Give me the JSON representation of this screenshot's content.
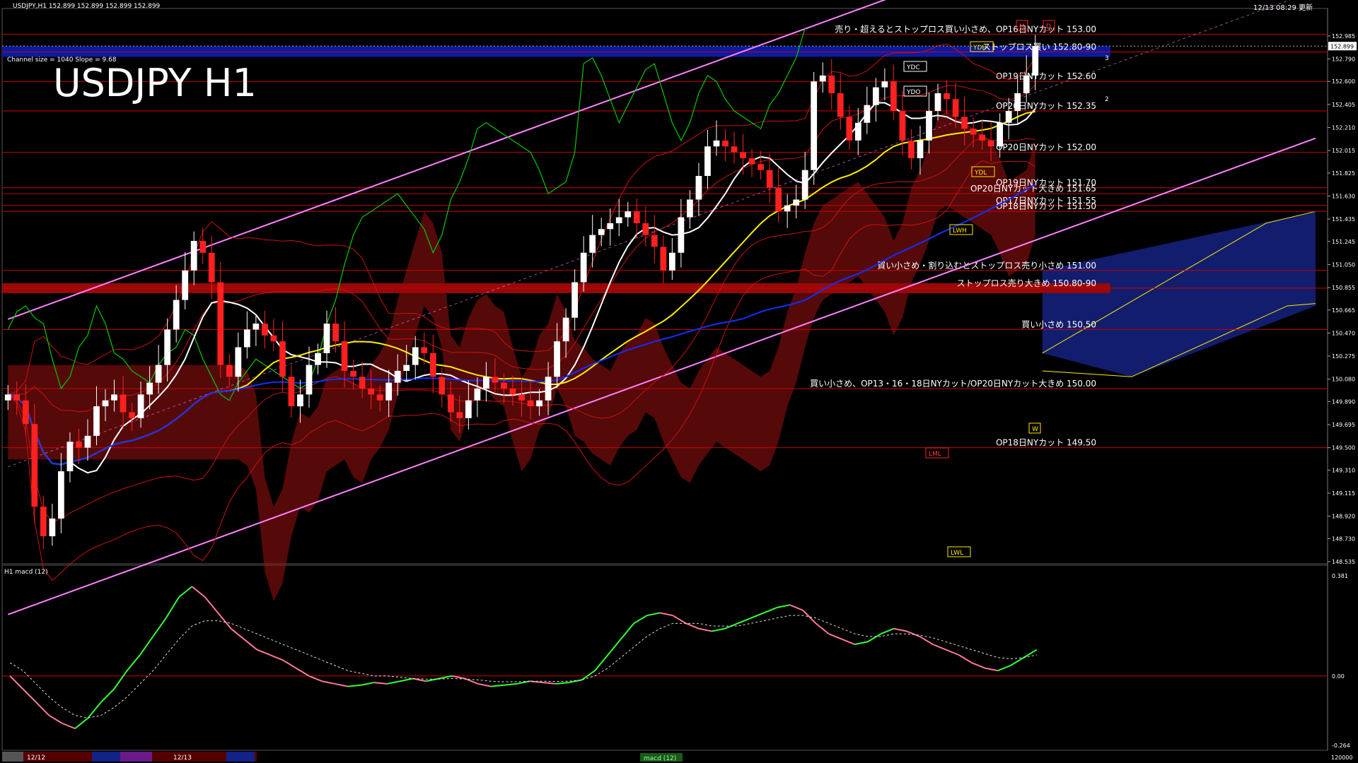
{
  "header": {
    "symbol_info": "USDJPY,H1  152.899 152.899 152.899 152.899",
    "datetime": "12/13 08:29 更新",
    "channel_info": "Channel size = 1040 Slope = 9.68",
    "big_title": "USDJPY H1"
  },
  "colors": {
    "bg": "#000000",
    "candle_up": "#ffffff",
    "candle_down": "#ff2020",
    "level_line": "#cc0000",
    "channel": "#ff80ff",
    "ma_white": "#ffffff",
    "ma_yellow": "#ffee00",
    "ma_blue": "#1030ff",
    "lagging_green": "#00cc00",
    "macd_green": "#33ff33",
    "macd_pink": "#ff7799",
    "kumo_red": "#9b1010",
    "kumo_blue": "#1b2a9b",
    "buy_zone": "#0a1aa0",
    "sell_zone": "#990808",
    "order_text": "#ffffff",
    "bar_color": "#ffe800"
  },
  "chart_data": [
    {
      "type": "candlestick",
      "title": "USDJPY H1",
      "y_ticks": [
        "152.985",
        "152.790",
        "152.600",
        "152.405",
        "152.210",
        "152.015",
        "151.825",
        "151.630",
        "151.435",
        "151.245",
        "151.050",
        "150.855",
        "150.665",
        "150.470",
        "150.275",
        "150.080",
        "149.890",
        "149.695",
        "149.500",
        "149.310",
        "149.115",
        "148.920",
        "148.730",
        "148.535"
      ],
      "current_price_label": "152.899",
      "ylim": [
        148.535,
        153.05
      ],
      "x_labels": [
        "12/12",
        "12/13"
      ],
      "close_series": [
        149.95,
        149.9,
        149.7,
        149.0,
        148.75,
        148.9,
        149.3,
        149.55,
        149.5,
        149.6,
        149.85,
        149.9,
        149.95,
        149.8,
        149.75,
        149.95,
        150.05,
        150.2,
        150.5,
        150.75,
        151.0,
        151.25,
        151.15,
        150.9,
        150.2,
        150.1,
        150.35,
        150.5,
        150.55,
        150.45,
        150.4,
        150.1,
        149.85,
        149.95,
        150.2,
        150.3,
        150.55,
        150.4,
        150.15,
        150.1,
        150.0,
        149.95,
        149.9,
        150.05,
        150.15,
        150.2,
        150.35,
        150.3,
        150.1,
        149.95,
        149.8,
        149.75,
        149.9,
        150.0,
        150.1,
        150.05,
        150.0,
        149.95,
        149.9,
        149.85,
        149.9,
        150.1,
        150.4,
        150.6,
        150.9,
        151.15,
        151.3,
        151.35,
        151.4,
        151.45,
        151.5,
        151.4,
        151.3,
        151.2,
        151.0,
        151.15,
        151.45,
        151.6,
        151.8,
        152.05,
        152.1,
        152.05,
        152.0,
        151.95,
        151.9,
        151.85,
        151.7,
        151.5,
        151.55,
        151.6,
        151.85,
        152.6,
        152.65,
        152.5,
        152.3,
        152.1,
        152.25,
        152.4,
        152.55,
        152.6,
        152.35,
        152.1,
        151.95,
        152.1,
        152.35,
        152.5,
        152.45,
        152.3,
        152.2,
        152.15,
        152.1,
        152.05,
        152.25,
        152.35,
        152.5,
        152.65,
        152.9
      ],
      "levels": [
        {
          "price": 153.0,
          "label": "売り・超えるとストップロス買い小さめ、OP16日NYカット 153.00",
          "zone": false
        },
        {
          "price": 152.85,
          "label": "ストップロス買い 152.80-90",
          "zone": "buy"
        },
        {
          "price": 152.6,
          "label": "OP19日NYカット 152.60",
          "zone": false
        },
        {
          "price": 152.35,
          "label": "OP20日NYカット 152.35",
          "zone": false
        },
        {
          "price": 152.0,
          "label": "OP20日NYカット 152.00",
          "zone": false
        },
        {
          "price": 151.7,
          "label": "OP19日NYカット 151.70",
          "zone": false
        },
        {
          "price": 151.65,
          "label": "OP20日NYカット大きめ 151.65",
          "zone": false
        },
        {
          "price": 151.55,
          "label": "OP17日NYカット 151.55",
          "zone": false
        },
        {
          "price": 151.5,
          "label": "OP18日NYカット 151.50",
          "zone": false
        },
        {
          "price": 151.0,
          "label": "買い小さめ・割り込むとストップロス売り小さめ 151.00",
          "zone": false
        },
        {
          "price": 150.85,
          "label": "ストップロス売り大きめ 150.80-90",
          "zone": "sell"
        },
        {
          "price": 150.5,
          "label": "買い小さめ 150.50",
          "zone": false
        },
        {
          "price": 150.0,
          "label": "買い小さめ、OP13・16・18日NYカット/OP20日NYカット大きめ 150.00",
          "zone": false
        },
        {
          "price": 149.5,
          "label": "OP18日NYカット 149.50",
          "zone": false
        }
      ],
      "tags": [
        "YDH",
        "YDC",
        "YDO",
        "YDL",
        "LWH",
        "LML",
        "LWL",
        "W",
        "M",
        "D",
        "2",
        "3"
      ]
    },
    {
      "type": "line",
      "title": "H1  macd (12)",
      "y_ticks": [
        "0.381",
        "0.00",
        "-0.264"
      ],
      "ylim": [
        -0.264,
        0.381
      ],
      "macd": [
        0.0,
        -0.05,
        -0.1,
        -0.15,
        -0.18,
        -0.2,
        -0.16,
        -0.1,
        -0.05,
        0.02,
        0.08,
        0.15,
        0.22,
        0.3,
        0.34,
        0.3,
        0.24,
        0.18,
        0.14,
        0.1,
        0.08,
        0.06,
        0.03,
        0.0,
        -0.02,
        -0.03,
        -0.04,
        -0.035,
        -0.025,
        -0.03,
        -0.02,
        -0.01,
        -0.02,
        -0.01,
        0.0,
        -0.01,
        -0.03,
        -0.04,
        -0.035,
        -0.03,
        -0.02,
        -0.025,
        -0.03,
        -0.025,
        -0.015,
        0.02,
        0.08,
        0.14,
        0.2,
        0.23,
        0.24,
        0.23,
        0.2,
        0.18,
        0.17,
        0.18,
        0.2,
        0.22,
        0.24,
        0.26,
        0.27,
        0.25,
        0.2,
        0.16,
        0.14,
        0.12,
        0.13,
        0.16,
        0.18,
        0.17,
        0.15,
        0.12,
        0.1,
        0.08,
        0.05,
        0.03,
        0.02,
        0.04,
        0.07,
        0.1
      ],
      "signal": [
        0.05,
        0.02,
        -0.03,
        -0.08,
        -0.12,
        -0.15,
        -0.16,
        -0.15,
        -0.12,
        -0.08,
        -0.03,
        0.02,
        0.08,
        0.14,
        0.19,
        0.21,
        0.21,
        0.2,
        0.18,
        0.16,
        0.14,
        0.12,
        0.1,
        0.08,
        0.06,
        0.04,
        0.02,
        0.01,
        0.0,
        0.0,
        -0.005,
        -0.01,
        -0.012,
        -0.012,
        -0.01,
        -0.012,
        -0.015,
        -0.02,
        -0.022,
        -0.022,
        -0.02,
        -0.02,
        -0.021,
        -0.02,
        -0.015,
        0.0,
        0.03,
        0.07,
        0.11,
        0.15,
        0.18,
        0.2,
        0.2,
        0.2,
        0.19,
        0.19,
        0.19,
        0.2,
        0.21,
        0.22,
        0.23,
        0.23,
        0.22,
        0.2,
        0.18,
        0.16,
        0.15,
        0.15,
        0.16,
        0.16,
        0.155,
        0.145,
        0.13,
        0.115,
        0.1,
        0.085,
        0.07,
        0.065,
        0.07,
        0.08
      ]
    }
  ],
  "footer": {
    "labels": [
      "12/12",
      "12/13"
    ],
    "tab": "macd (12)",
    "volume_value": "120000"
  }
}
